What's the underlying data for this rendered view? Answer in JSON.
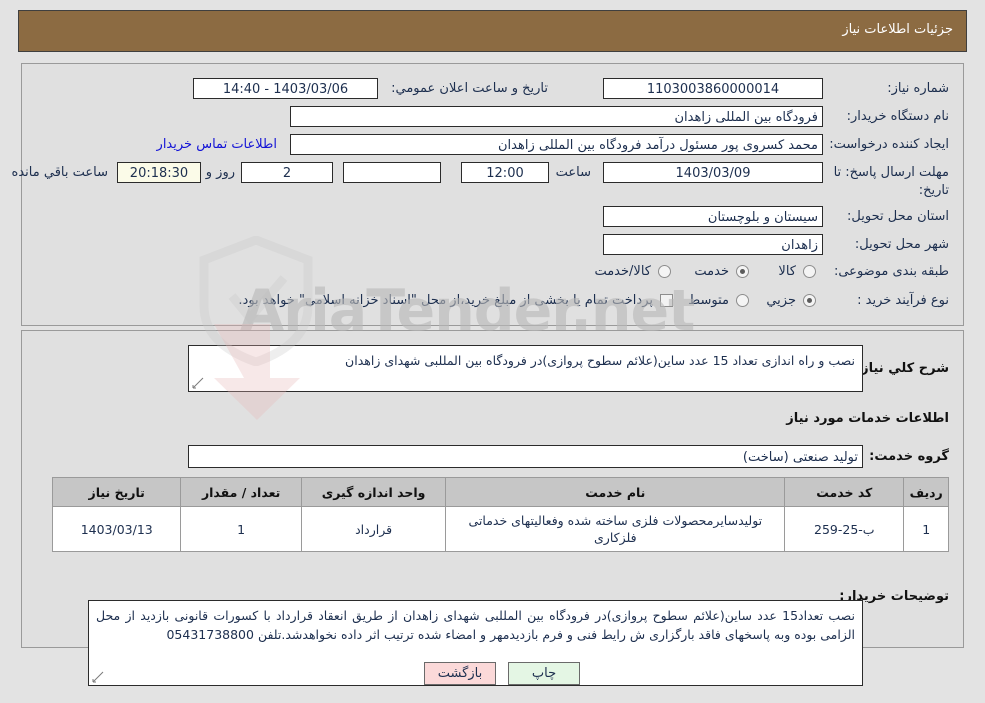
{
  "header": {
    "title": "جزئیات اطلاعات نیاز"
  },
  "form": {
    "need_number_label": "شماره نیاز:",
    "need_number_value": "1103003860000014",
    "public_announce_label": "تاریخ و ساعت اعلان عمومي:",
    "public_announce_value": "1403/03/06 - 14:40",
    "buyer_org_label": "نام دستگاه خریدار:",
    "buyer_org_value": "فرودگاه بین المللی زاهدان",
    "requester_label": "ایجاد کننده درخواست:",
    "requester_value": "محمد کسروی پور مسئول درآمد فرودگاه بین المللی زاهدان",
    "buyer_contact_link": "اطلاعات تماس خریدار",
    "deadline_label_line1": "مهلت ارسال پاسخ: تا",
    "deadline_label_line2": "تاریخ:",
    "deadline_date": "1403/03/09",
    "hour_label": "ساعت",
    "deadline_time": "12:00",
    "empty_box_value": "",
    "days_value": "2",
    "days_label": "روز و",
    "countdown_value": "20:18:30",
    "countdown_label": "ساعت باقي مانده",
    "province_label": "استان محل تحویل:",
    "province_value": "سیستان و بلوچستان",
    "city_label": "شهر محل تحویل:",
    "city_value": "زاهدان",
    "category_label": "طبقه بندی موضوعی:",
    "category_options": [
      {
        "label": "کالا",
        "selected": false
      },
      {
        "label": "خدمت",
        "selected": true
      },
      {
        "label": "کالا/خدمت",
        "selected": false
      }
    ],
    "process_label": "نوع فرآیند خرید :",
    "process_options": [
      {
        "label": "جزیي",
        "selected": true
      },
      {
        "label": "متوسط",
        "selected": false
      }
    ],
    "treasury_checkbox_label": "پرداخت تمام یا بخشی از مبلغ خرید،از محل \"اسناد خزانه اسلامی\" خواهد بود.",
    "treasury_checked": false
  },
  "body": {
    "general_desc_label": "شرح کلي نیاز:",
    "general_desc_value": "نصب و راه اندازی تعداد 15 عدد ساین(علائم سطوح پروازی)در فرودگاه بین المللبی شهدای زاهدان",
    "services_info_heading": "اطلاعات خدمات مورد نیاز",
    "service_group_label": "گروه خدمت:",
    "service_group_value": "تولید صنعتی (ساخت)",
    "buyer_notes_label": "توضیحات خریدار:",
    "buyer_notes_value": "نصب تعداد15 عدد ساین(علائم سطوح پروازی)در فرودگاه بین المللبی شهدای زاهدان از طریق انعقاد قرارداد با کسورات قانونی بازدید از محل الزامی بوده وبه پاسخهای فاقد بارگزاری ش رایط فنی و فرم بازدیدمهر و امضاء شده ترتیب اثر داده نخواهدشد.تلفن 05431738800"
  },
  "table": {
    "columns": [
      "ردیف",
      "کد خدمت",
      "نام خدمت",
      "واحد اندازه گیری",
      "تعداد / مقدار",
      "تاریخ نیاز"
    ],
    "rows": [
      {
        "row_no": "1",
        "service_code": "ب-25-259",
        "service_name": "تولیدسایرمحصولات فلزی ساخته شده وفعالیتهای خدماتی فلزکاری",
        "unit": "قرارداد",
        "quantity": "1",
        "need_date": "1403/03/13"
      }
    ]
  },
  "footer": {
    "print_label": "چاپ",
    "back_label": "بازگشت"
  },
  "watermark": {
    "text": "AriaTender.net"
  },
  "colors": {
    "header_brown": "#8c6b42",
    "panel_gray": "#e0e0e0",
    "page_gray": "#e3e3e3",
    "link_blue": "#1414d6",
    "table_header": "#c6c6c6",
    "print_green": "#e4f6e4",
    "back_pink": "#fbd9d9"
  }
}
